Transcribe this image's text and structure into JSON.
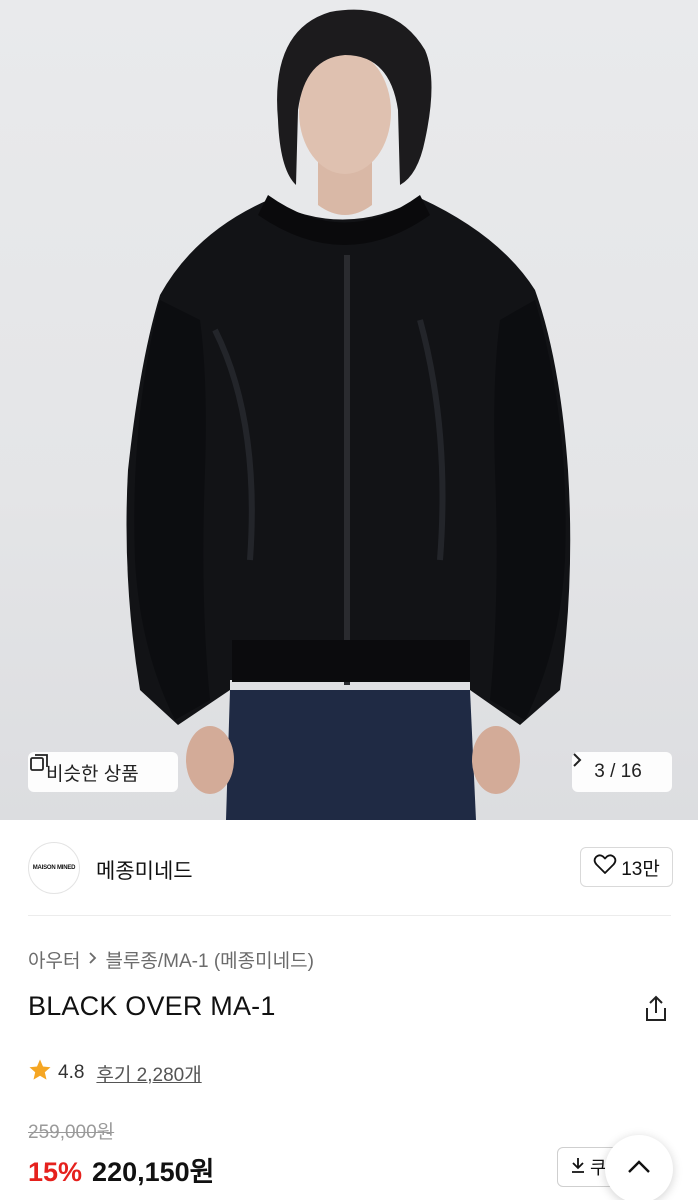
{
  "gallery": {
    "similar_label": "비슷한 상품",
    "counter": "3 / 16"
  },
  "brand": {
    "logo_text": "MAISON MINED",
    "name": "메종미네드",
    "like_count": "13만"
  },
  "product": {
    "breadcrumb": [
      "아우터",
      "블루종/MA-1 (메종미네드)"
    ],
    "title": "BLACK OVER MA-1",
    "rating": "4.8",
    "reviews": "후기 2,280개",
    "original_price": "259,000원",
    "discount": "15%",
    "price": "220,150원",
    "coupon_label": "쿠폰"
  },
  "colors": {
    "accent_red": "#e5211d",
    "star": "#f5a623"
  },
  "icons": [
    "similar-items-icon",
    "chevron-right-icon",
    "heart-icon",
    "share-icon",
    "star-icon",
    "download-icon",
    "scroll-top-icon"
  ]
}
